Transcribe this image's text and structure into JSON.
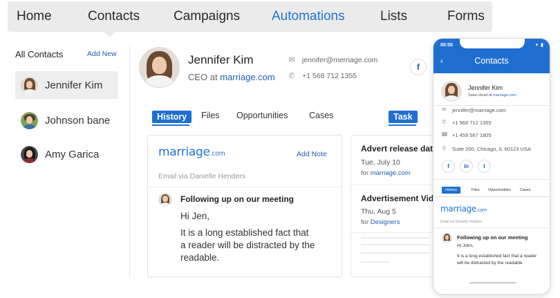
{
  "nav": {
    "items": [
      "Home",
      "Contacts",
      "Campaigns",
      "Automations",
      "Lists",
      "Forms"
    ],
    "active": "Automations"
  },
  "sidebar": {
    "title": "All Contacts",
    "add_new": "Add New",
    "contacts": [
      {
        "name": "Jennifer Kim",
        "active": true
      },
      {
        "name": "Johnson bane",
        "active": false
      },
      {
        "name": "Amy Garica",
        "active": false
      }
    ]
  },
  "profile": {
    "name": "Jennifer Kim",
    "role_prefix": "CEO at",
    "company": "marriage.com",
    "email": "jennifer@merriage.com",
    "phone": "+1 568 712 1355"
  },
  "tabs": {
    "history": "History",
    "files": "Files",
    "opportunities": "Opportunities",
    "cases": "Cases",
    "task": "Task"
  },
  "history_card": {
    "logo_main": "marriage",
    "logo_suffix": ".com",
    "add_note": "Add Note",
    "email_via": "Email via Danielle Henders",
    "subject": "Following up on our meeting",
    "greeting": "Hi Jen,",
    "body_lines": [
      "It is a long established fact that",
      "a reader will be distracted by the",
      "readable."
    ]
  },
  "task_card": {
    "items": [
      {
        "title": "Advert release date",
        "date": "Tue, July 10",
        "for_prefix": "for",
        "for_link": "marriage.com"
      },
      {
        "title": "Advertisement Video",
        "date": "Thu, Aug 5",
        "for_prefix": "for",
        "for_link": "Designers"
      }
    ]
  },
  "phone": {
    "time": "00:00",
    "status_icons": "▾ ▮",
    "back": "‹",
    "title": "Contacts",
    "name": "Jennifer Kim",
    "role_prefix": "Sales Head at",
    "company": "marriage.com",
    "email": "jennifer@marriage.com",
    "phone1": "+1 568 712 1355",
    "phone2": "+1 459 567 1805",
    "address": "Suite 200, Chicago, IL 60123 USA",
    "social": [
      "f",
      "in",
      "t"
    ],
    "tabs": [
      "History",
      "Files",
      "Opportunities",
      "Cases"
    ],
    "logo_main": "marriage",
    "logo_suffix": ".com",
    "email_via": "Email via Danielle Henders",
    "subject": "Following up on our meeting",
    "greeting": "Hi John,",
    "body_lines": [
      "It is a long established fact that a reader",
      "will be distracted by the readable"
    ]
  },
  "colors": {
    "accent": "#1f6fd0",
    "nav_bg": "#ebebeb",
    "link": "#1f5fb0"
  }
}
